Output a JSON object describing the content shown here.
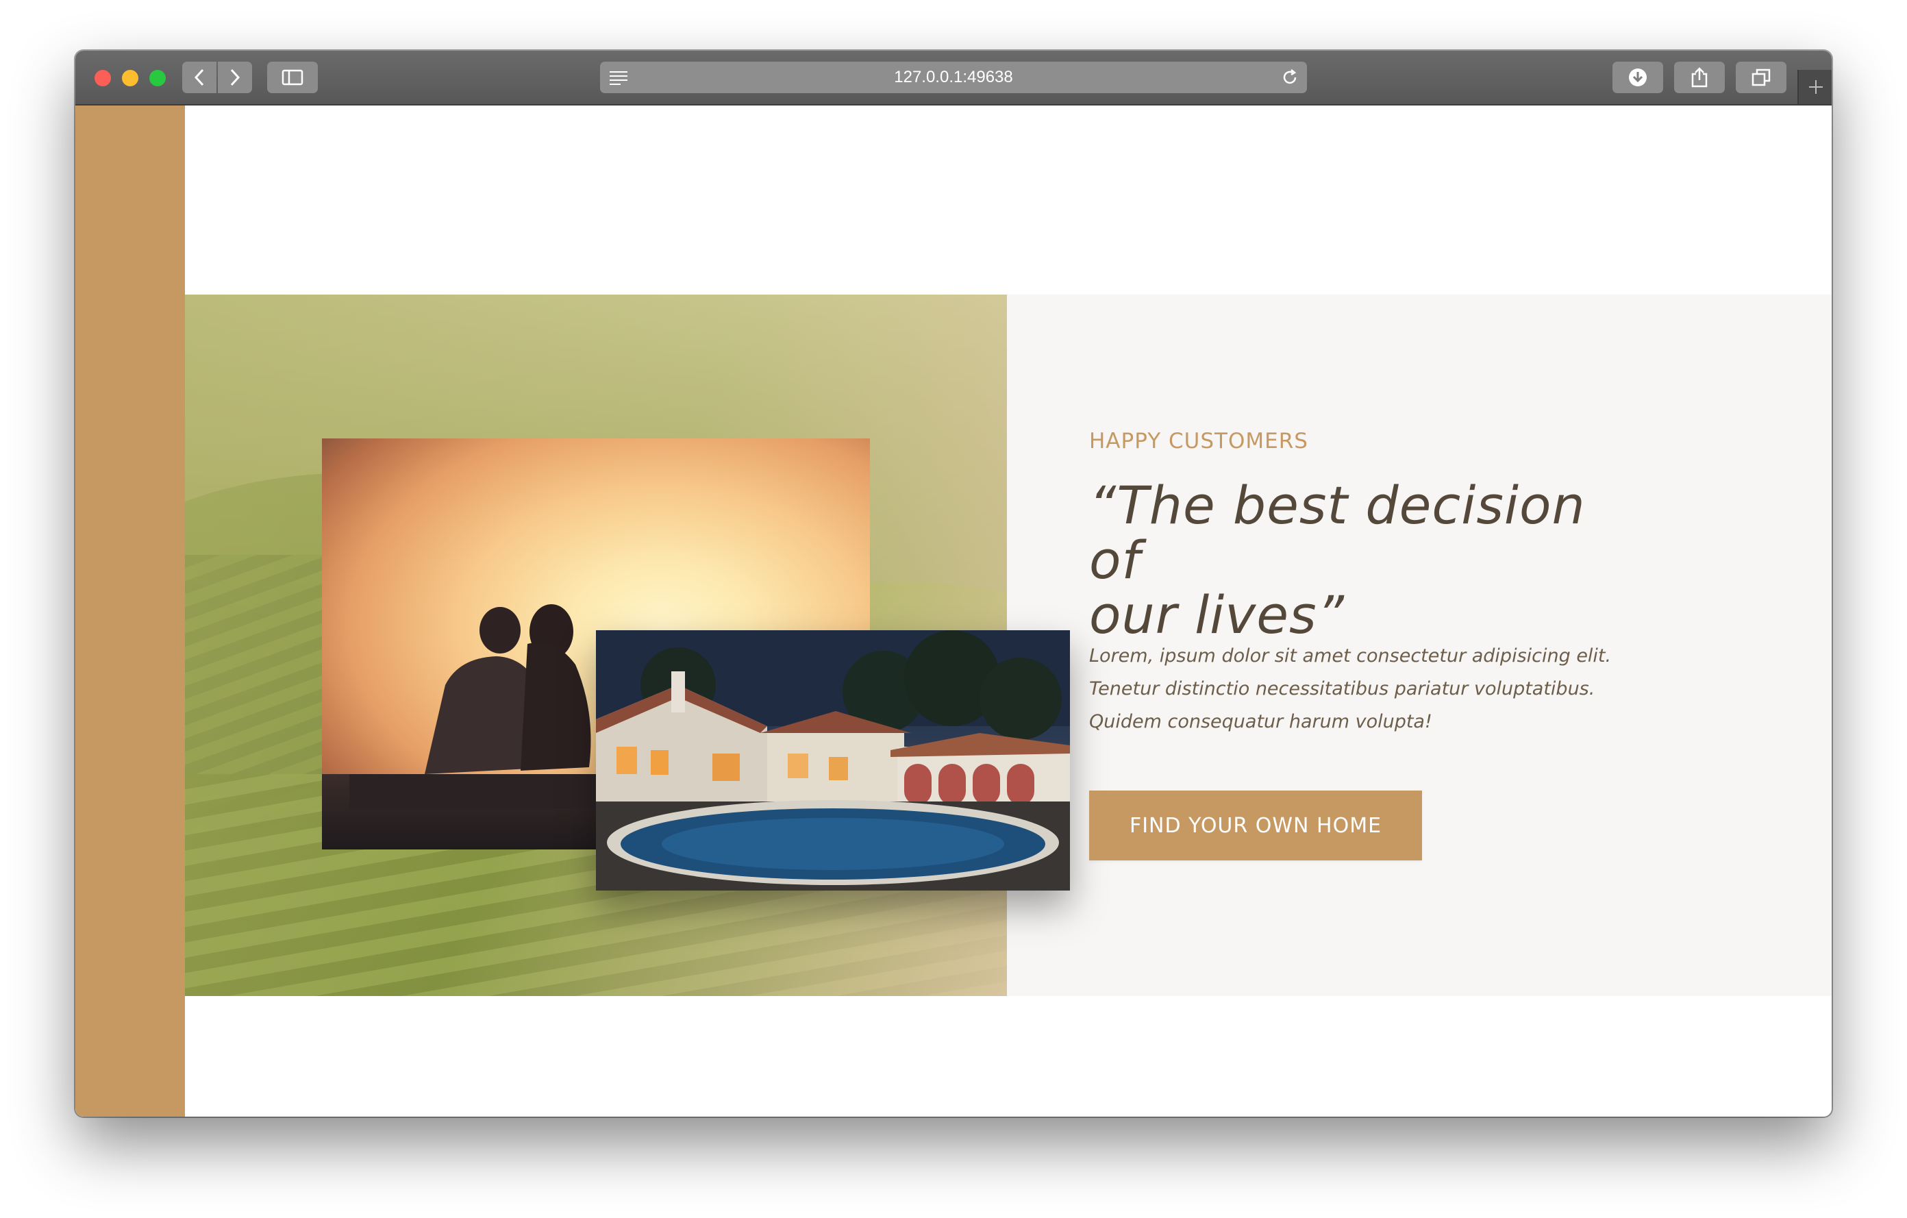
{
  "browser": {
    "url": "127.0.0.1:49638"
  },
  "section": {
    "subheading": "HAPPY CUSTOMERS",
    "quote_line1": "“The best decision of",
    "quote_line2": "our lives”",
    "paragraph_line1": "Lorem, ipsum dolor sit amet consectetur adipisicing elit.",
    "paragraph_line2": "Tenetur distinctio necessitatibus pariatur voluptatibus.",
    "paragraph_line3": "Quidem consequatur harum volupta!",
    "cta_label": "FIND YOUR OWN HOME"
  },
  "colors": {
    "accent": "#c69963",
    "heading": "#54483a",
    "body_text": "#6d5d4b",
    "section_bg": "#f7f6f4"
  }
}
